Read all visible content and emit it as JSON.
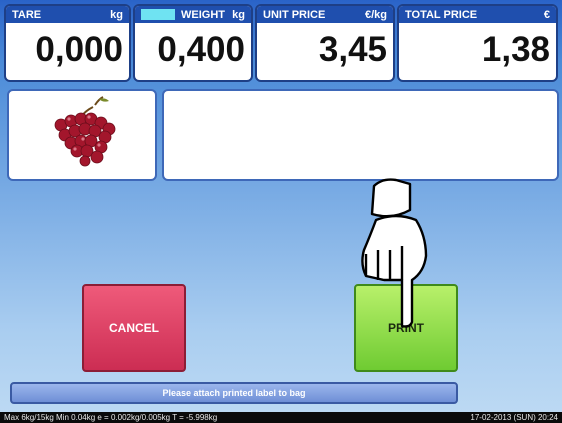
{
  "panels": {
    "tare": {
      "label": "TARE",
      "unit": "kg",
      "value": "0,000"
    },
    "weight": {
      "label": "WEIGHT",
      "unit": "kg",
      "value": "0,400"
    },
    "unit_price": {
      "label": "UNIT PRICE",
      "unit": "€/kg",
      "value": "3,45"
    },
    "total_price": {
      "label": "TOTAL PRICE",
      "unit": "€",
      "value": "1,38"
    }
  },
  "product": {
    "image_icon": "red-grapes-icon",
    "description": ""
  },
  "buttons": {
    "cancel": "CANCEL",
    "print": "PRINT"
  },
  "message": "Please attach printed label to bag",
  "status": {
    "left": "Max 6kg/15kg  Min 0.04kg  e = 0.002kg/0.005kg  T = -5.998kg",
    "right": "17-02-2013 (SUN)  20:24"
  },
  "colors": {
    "cancel": "#cc2d53",
    "print": "#6fcb32",
    "header": "#1f4fae"
  }
}
